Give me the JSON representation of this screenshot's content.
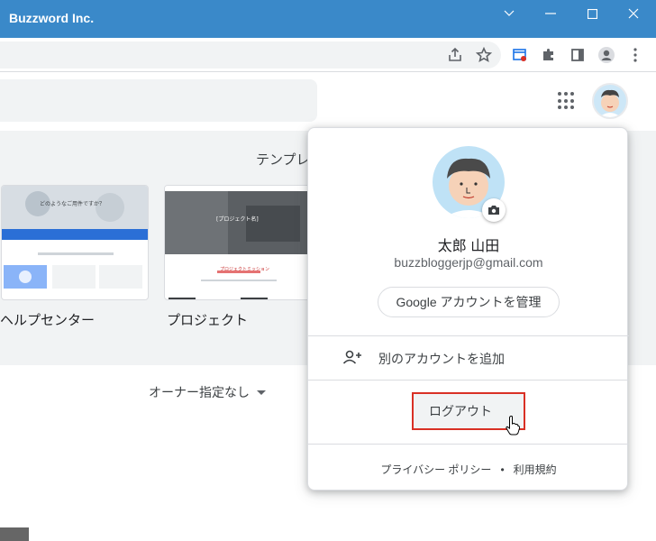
{
  "window": {
    "title": "Buzzword Inc."
  },
  "window_controls": [
    "chevron-down-icon",
    "minimize-icon",
    "maximize-icon",
    "close-icon"
  ],
  "toolbar_icons": [
    "share-icon",
    "star-icon",
    "extension-page-icon",
    "puzzle-icon",
    "side-panel-icon",
    "profile-icon",
    "kebab-menu-icon"
  ],
  "templates": {
    "heading": "テンプレ",
    "items": [
      {
        "label": "ヘルプセンター",
        "thumb_headline": "どのようなご用件ですか？"
      },
      {
        "label": "プロジェクト",
        "thumb_headline": "[プロジェクト名]",
        "thumb_sub": "プロジェクトミッション"
      }
    ]
  },
  "owner_filter": {
    "label": "オーナー指定なし"
  },
  "account_popup": {
    "name": "太郎 山田",
    "email": "buzzbloggerjp@gmail.com",
    "manage_label": "Google アカウントを管理",
    "add_account_label": "別のアカウントを追加",
    "logout_label": "ログアウト",
    "privacy_label": "プライバシー ポリシー",
    "separator": "•",
    "terms_label": "利用規約"
  },
  "colors": {
    "titlebar": "#3a89c9",
    "highlight": "#d93025",
    "thumb_banner": "#2b6fd6"
  }
}
